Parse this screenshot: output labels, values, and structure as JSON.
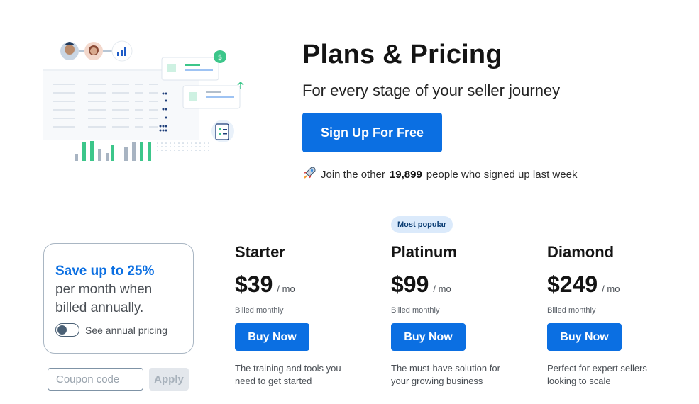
{
  "hero": {
    "title": "Plans & Pricing",
    "subtitle": "For every stage of your seller journey",
    "signup_label": "Sign Up For Free",
    "join_prefix": "Join the other",
    "join_count": "19,899",
    "join_suffix": "people who signed up last week",
    "join_icon": "rocket-icon"
  },
  "save_box": {
    "highlight": "Save up to 25%",
    "rest": "per month when billed annually.",
    "toggle_label": "See annual pricing",
    "toggle_on": false
  },
  "coupon": {
    "placeholder": "Coupon code",
    "apply_label": "Apply"
  },
  "badge": {
    "label": "Most popular"
  },
  "plans": [
    {
      "name": "Starter",
      "price": "$39",
      "per": "/ mo",
      "billed": "Billed monthly",
      "button": "Buy Now",
      "description": "The training and tools you need to get started"
    },
    {
      "name": "Platinum",
      "price": "$99",
      "per": "/ mo",
      "billed": "Billed monthly",
      "button": "Buy Now",
      "description": "The must-have solution for your growing business"
    },
    {
      "name": "Diamond",
      "price": "$249",
      "per": "/ mo",
      "billed": "Billed monthly",
      "button": "Buy Now",
      "description": "Perfect for expert sellers looking to scale"
    }
  ],
  "colors": {
    "primary": "#0b6fe2",
    "accent_green": "#3cc68a",
    "badge_bg": "#dbeafb"
  }
}
